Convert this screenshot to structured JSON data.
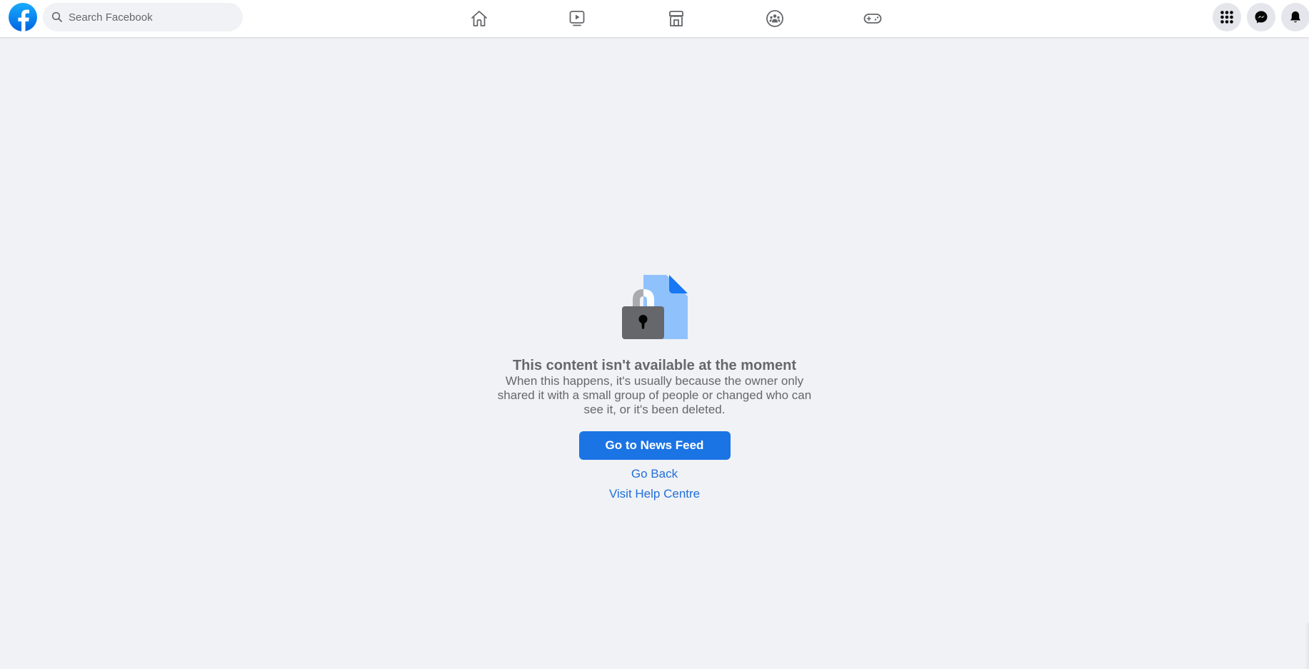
{
  "header": {
    "logo": {
      "icon": "facebook-logo-icon",
      "label": "Facebook"
    },
    "search": {
      "placeholder": "Search Facebook",
      "value": "",
      "icon": "search-icon"
    },
    "nav": [
      {
        "id": "home",
        "label": "Home",
        "icon": "home-icon"
      },
      {
        "id": "watch",
        "label": "Watch",
        "icon": "video-icon"
      },
      {
        "id": "marketplace",
        "label": "Marketplace",
        "icon": "marketplace-icon"
      },
      {
        "id": "groups",
        "label": "Groups",
        "icon": "groups-icon"
      },
      {
        "id": "gaming",
        "label": "Gaming",
        "icon": "gaming-icon"
      }
    ],
    "right_buttons": [
      {
        "id": "menu",
        "label": "Menu",
        "icon": "grid-menu-icon"
      },
      {
        "id": "messenger",
        "label": "Messenger",
        "icon": "messenger-icon"
      },
      {
        "id": "notifications",
        "label": "Notifications",
        "icon": "bell-icon"
      }
    ]
  },
  "main": {
    "illustration": "locked-content-icon",
    "title": "This content isn't available at the moment",
    "description": "When this happens, it's usually because the owner only shared it with a small group of people or changed who can see it, or it's been deleted.",
    "primary_button": "Go to News Feed",
    "links": [
      "Go Back",
      "Visit Help Centre"
    ]
  },
  "colors": {
    "brand_blue": "#1b74e4",
    "link_blue": "#216fdb",
    "page_background": "#f0f2f5",
    "secondary_text": "#65676b"
  }
}
